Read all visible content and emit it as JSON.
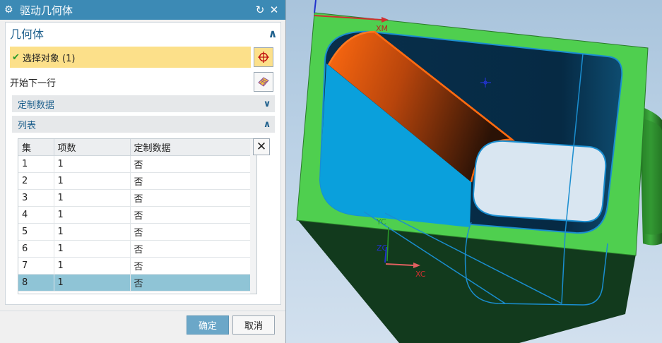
{
  "dialog": {
    "title": "驱动几何体",
    "reset_icon": "↻",
    "close_icon": "✕"
  },
  "geometry": {
    "header": "几何体",
    "select_label": "选择对象 (1)",
    "next_row_label": "开始下一行",
    "custom_data_header": "定制数据",
    "list_header": "列表"
  },
  "list": {
    "columns": [
      "集",
      "项数",
      "定制数据"
    ],
    "rows": [
      [
        "1",
        "1",
        "否"
      ],
      [
        "2",
        "1",
        "否"
      ],
      [
        "3",
        "1",
        "否"
      ],
      [
        "4",
        "1",
        "否"
      ],
      [
        "5",
        "1",
        "否"
      ],
      [
        "6",
        "1",
        "否"
      ],
      [
        "7",
        "1",
        "否"
      ],
      [
        "8",
        "1",
        "否"
      ]
    ],
    "selected_row": 8
  },
  "buttons": {
    "ok": "确定",
    "cancel": "取消"
  },
  "viewport": {
    "axis_xm": "XM",
    "axis_yc": "YC",
    "axis_zc": "ZC",
    "axis_xc": "XC"
  },
  "colors": {
    "title_bar": "#3c8ab5",
    "selection_highlight": "#fce08a",
    "selected_row": "#8fc4d6",
    "ok_button": "#6ba7c8",
    "part_green": "#4fcf4f",
    "part_dark_green": "#123a1d",
    "pocket_navy": "#062c46",
    "pocket_blue": "#0aa0dc",
    "edge_orange": "#ff6a10"
  }
}
